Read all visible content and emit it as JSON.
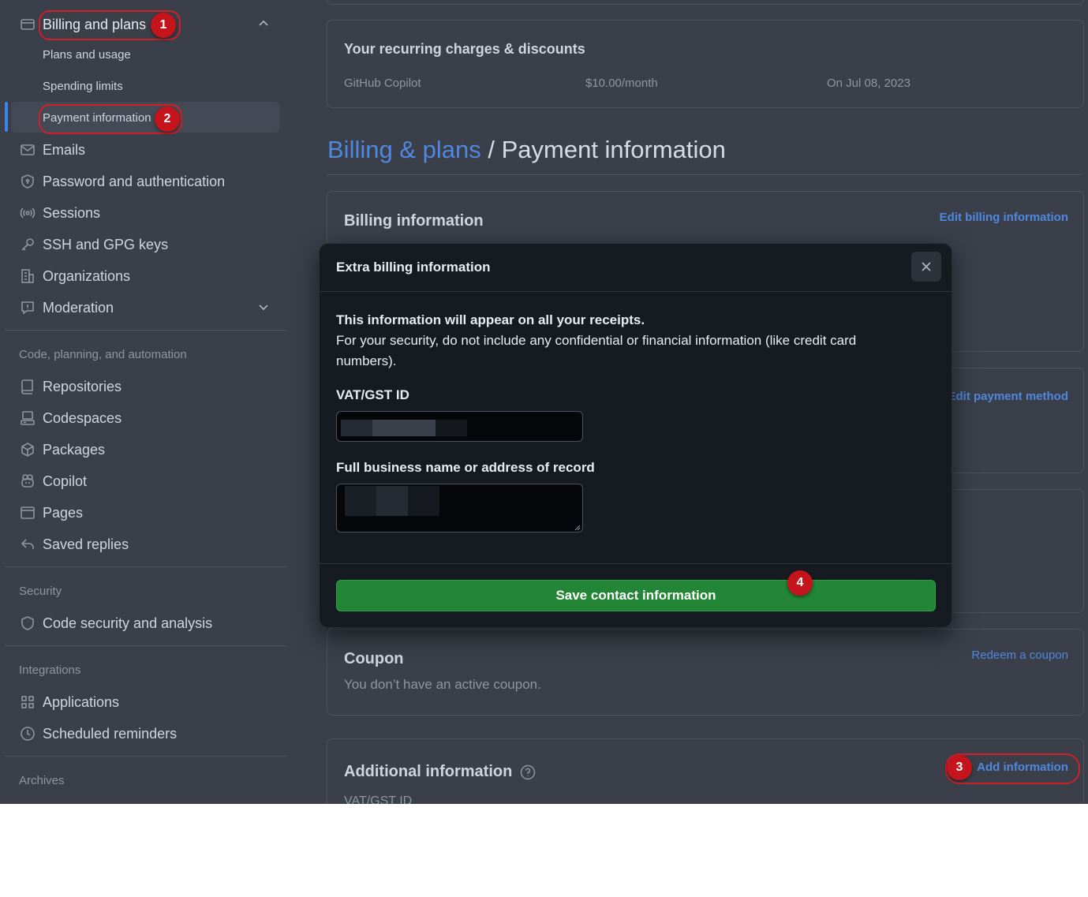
{
  "sidebar": {
    "billing": {
      "label": "Billing and plans",
      "subitems": [
        "Plans and usage",
        "Spending limits",
        "Payment information"
      ]
    },
    "items": [
      {
        "label": "Emails",
        "icon": "mail-icon"
      },
      {
        "label": "Password and authentication",
        "icon": "shield-lock-icon"
      },
      {
        "label": "Sessions",
        "icon": "broadcast-icon"
      },
      {
        "label": "SSH and GPG keys",
        "icon": "key-icon"
      },
      {
        "label": "Organizations",
        "icon": "organization-icon"
      },
      {
        "label": "Moderation",
        "icon": "report-icon"
      }
    ],
    "sections": {
      "code": {
        "title": "Code, planning, and automation",
        "items": [
          {
            "label": "Repositories",
            "icon": "repo-icon"
          },
          {
            "label": "Codespaces",
            "icon": "codespaces-icon"
          },
          {
            "label": "Packages",
            "icon": "package-icon"
          },
          {
            "label": "Copilot",
            "icon": "copilot-icon"
          },
          {
            "label": "Pages",
            "icon": "browser-icon"
          },
          {
            "label": "Saved replies",
            "icon": "reply-icon"
          }
        ]
      },
      "security": {
        "title": "Security",
        "items": [
          {
            "label": "Code security and analysis",
            "icon": "shield-icon"
          }
        ]
      },
      "integrations": {
        "title": "Integrations",
        "items": [
          {
            "label": "Applications",
            "icon": "apps-icon"
          },
          {
            "label": "Scheduled reminders",
            "icon": "clock-icon"
          }
        ]
      },
      "archives": {
        "title": "Archives"
      }
    }
  },
  "annotations": [
    "1",
    "2",
    "3",
    "4"
  ],
  "main": {
    "recurring": {
      "title": "Your recurring charges & discounts",
      "product": "GitHub Copilot",
      "price": "$10.00/month",
      "date": "On Jul 08, 2023"
    },
    "breadcrumb": {
      "parent": "Billing & plans",
      "separator": "/",
      "current": "Payment information"
    },
    "billing_info": {
      "title": "Billing information",
      "edit": "Edit billing information"
    },
    "payment": {
      "edit": "Edit payment method"
    },
    "coupon": {
      "title": "Coupon",
      "text": "You don’t have an active coupon.",
      "action": "Redeem a coupon"
    },
    "additional": {
      "title": "Additional information",
      "action": "Add information",
      "vat_label": "VAT/GST ID"
    }
  },
  "modal": {
    "title": "Extra billing information",
    "intro_bold": "This information will appear on all your receipts.",
    "intro": "For your security, do not include any confidential or financial information (like credit card numbers).",
    "vat_label": "VAT/GST ID",
    "business_label": "Full business name or address of record",
    "save_label": "Save contact information"
  },
  "colors": {
    "accent": "#4f88de",
    "primary_button": "#238636",
    "annotation": "#c5141c"
  }
}
